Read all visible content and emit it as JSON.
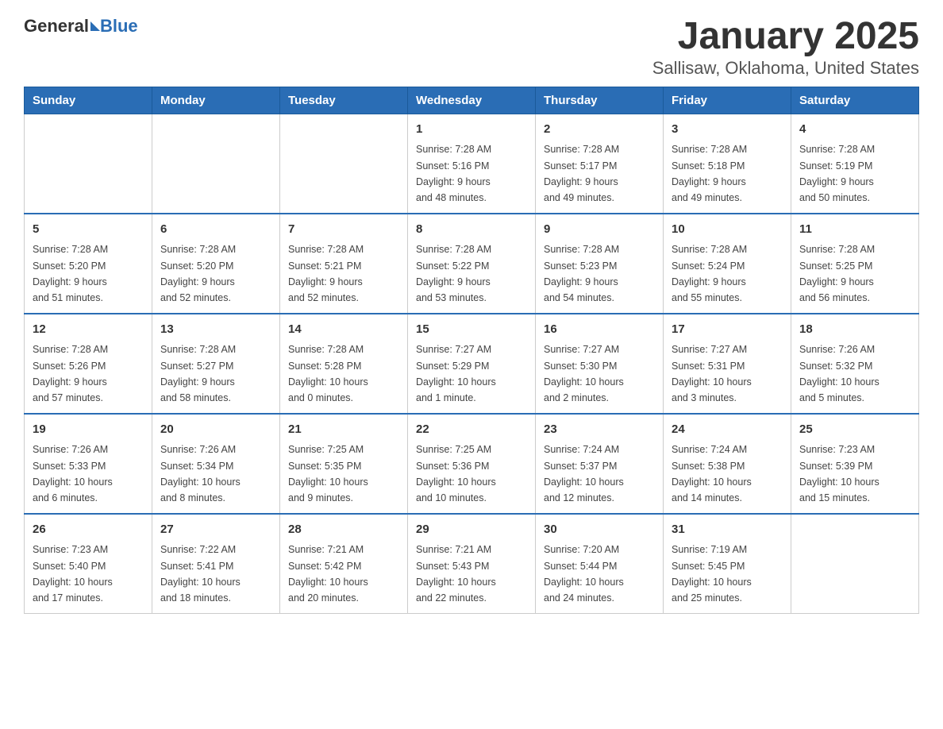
{
  "header": {
    "logo_general": "General",
    "logo_blue": "Blue",
    "title": "January 2025",
    "subtitle": "Sallisaw, Oklahoma, United States"
  },
  "days_of_week": [
    "Sunday",
    "Monday",
    "Tuesday",
    "Wednesday",
    "Thursday",
    "Friday",
    "Saturday"
  ],
  "weeks": [
    [
      {
        "day": "",
        "info": ""
      },
      {
        "day": "",
        "info": ""
      },
      {
        "day": "",
        "info": ""
      },
      {
        "day": "1",
        "info": "Sunrise: 7:28 AM\nSunset: 5:16 PM\nDaylight: 9 hours\nand 48 minutes."
      },
      {
        "day": "2",
        "info": "Sunrise: 7:28 AM\nSunset: 5:17 PM\nDaylight: 9 hours\nand 49 minutes."
      },
      {
        "day": "3",
        "info": "Sunrise: 7:28 AM\nSunset: 5:18 PM\nDaylight: 9 hours\nand 49 minutes."
      },
      {
        "day": "4",
        "info": "Sunrise: 7:28 AM\nSunset: 5:19 PM\nDaylight: 9 hours\nand 50 minutes."
      }
    ],
    [
      {
        "day": "5",
        "info": "Sunrise: 7:28 AM\nSunset: 5:20 PM\nDaylight: 9 hours\nand 51 minutes."
      },
      {
        "day": "6",
        "info": "Sunrise: 7:28 AM\nSunset: 5:20 PM\nDaylight: 9 hours\nand 52 minutes."
      },
      {
        "day": "7",
        "info": "Sunrise: 7:28 AM\nSunset: 5:21 PM\nDaylight: 9 hours\nand 52 minutes."
      },
      {
        "day": "8",
        "info": "Sunrise: 7:28 AM\nSunset: 5:22 PM\nDaylight: 9 hours\nand 53 minutes."
      },
      {
        "day": "9",
        "info": "Sunrise: 7:28 AM\nSunset: 5:23 PM\nDaylight: 9 hours\nand 54 minutes."
      },
      {
        "day": "10",
        "info": "Sunrise: 7:28 AM\nSunset: 5:24 PM\nDaylight: 9 hours\nand 55 minutes."
      },
      {
        "day": "11",
        "info": "Sunrise: 7:28 AM\nSunset: 5:25 PM\nDaylight: 9 hours\nand 56 minutes."
      }
    ],
    [
      {
        "day": "12",
        "info": "Sunrise: 7:28 AM\nSunset: 5:26 PM\nDaylight: 9 hours\nand 57 minutes."
      },
      {
        "day": "13",
        "info": "Sunrise: 7:28 AM\nSunset: 5:27 PM\nDaylight: 9 hours\nand 58 minutes."
      },
      {
        "day": "14",
        "info": "Sunrise: 7:28 AM\nSunset: 5:28 PM\nDaylight: 10 hours\nand 0 minutes."
      },
      {
        "day": "15",
        "info": "Sunrise: 7:27 AM\nSunset: 5:29 PM\nDaylight: 10 hours\nand 1 minute."
      },
      {
        "day": "16",
        "info": "Sunrise: 7:27 AM\nSunset: 5:30 PM\nDaylight: 10 hours\nand 2 minutes."
      },
      {
        "day": "17",
        "info": "Sunrise: 7:27 AM\nSunset: 5:31 PM\nDaylight: 10 hours\nand 3 minutes."
      },
      {
        "day": "18",
        "info": "Sunrise: 7:26 AM\nSunset: 5:32 PM\nDaylight: 10 hours\nand 5 minutes."
      }
    ],
    [
      {
        "day": "19",
        "info": "Sunrise: 7:26 AM\nSunset: 5:33 PM\nDaylight: 10 hours\nand 6 minutes."
      },
      {
        "day": "20",
        "info": "Sunrise: 7:26 AM\nSunset: 5:34 PM\nDaylight: 10 hours\nand 8 minutes."
      },
      {
        "day": "21",
        "info": "Sunrise: 7:25 AM\nSunset: 5:35 PM\nDaylight: 10 hours\nand 9 minutes."
      },
      {
        "day": "22",
        "info": "Sunrise: 7:25 AM\nSunset: 5:36 PM\nDaylight: 10 hours\nand 10 minutes."
      },
      {
        "day": "23",
        "info": "Sunrise: 7:24 AM\nSunset: 5:37 PM\nDaylight: 10 hours\nand 12 minutes."
      },
      {
        "day": "24",
        "info": "Sunrise: 7:24 AM\nSunset: 5:38 PM\nDaylight: 10 hours\nand 14 minutes."
      },
      {
        "day": "25",
        "info": "Sunrise: 7:23 AM\nSunset: 5:39 PM\nDaylight: 10 hours\nand 15 minutes."
      }
    ],
    [
      {
        "day": "26",
        "info": "Sunrise: 7:23 AM\nSunset: 5:40 PM\nDaylight: 10 hours\nand 17 minutes."
      },
      {
        "day": "27",
        "info": "Sunrise: 7:22 AM\nSunset: 5:41 PM\nDaylight: 10 hours\nand 18 minutes."
      },
      {
        "day": "28",
        "info": "Sunrise: 7:21 AM\nSunset: 5:42 PM\nDaylight: 10 hours\nand 20 minutes."
      },
      {
        "day": "29",
        "info": "Sunrise: 7:21 AM\nSunset: 5:43 PM\nDaylight: 10 hours\nand 22 minutes."
      },
      {
        "day": "30",
        "info": "Sunrise: 7:20 AM\nSunset: 5:44 PM\nDaylight: 10 hours\nand 24 minutes."
      },
      {
        "day": "31",
        "info": "Sunrise: 7:19 AM\nSunset: 5:45 PM\nDaylight: 10 hours\nand 25 minutes."
      },
      {
        "day": "",
        "info": ""
      }
    ]
  ]
}
